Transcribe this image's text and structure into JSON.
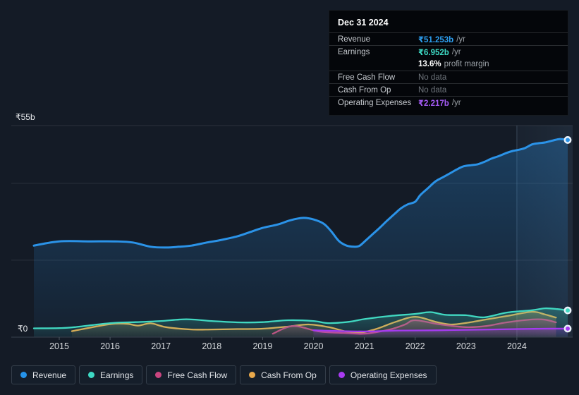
{
  "background": "#141B26",
  "tooltip": {
    "date": "Dec 31 2024",
    "rows": [
      {
        "name": "revenue",
        "label": "Revenue",
        "value": "₹51.253b",
        "suffix": "/yr",
        "value_color": "#2D9FF0",
        "no_data": false,
        "separator_above": false
      },
      {
        "name": "earnings",
        "label": "Earnings",
        "value": "₹6.952b",
        "suffix": "/yr",
        "value_color": "#3DD9C4",
        "no_data": false,
        "separator_above": true
      },
      {
        "name": "profit-margin",
        "label": "",
        "value": "13.6%",
        "suffix": "profit margin",
        "value_color": "#FFFFFF",
        "no_data": false,
        "separator_above": false
      },
      {
        "name": "free-cash-flow",
        "label": "Free Cash Flow",
        "value": "No data",
        "suffix": "",
        "value_color": "#6E747B",
        "no_data": true,
        "separator_above": true
      },
      {
        "name": "cash-from-op",
        "label": "Cash From Op",
        "value": "No data",
        "suffix": "",
        "value_color": "#6E747B",
        "no_data": true,
        "separator_above": true
      },
      {
        "name": "operating-expenses",
        "label": "Operating Expenses",
        "value": "₹2.217b",
        "suffix": "/yr",
        "value_color": "#A55BF5",
        "no_data": false,
        "separator_above": true
      }
    ]
  },
  "axis": {
    "y_top_label": "₹55b",
    "y_zero_label": "₹0"
  },
  "legend": {
    "items": [
      {
        "label": "Revenue",
        "color": "#2593EA"
      },
      {
        "label": "Earnings",
        "color": "#3DD9C4"
      },
      {
        "label": "Free Cash Flow",
        "color": "#C9457F"
      },
      {
        "label": "Cash From Op",
        "color": "#E9A94B"
      },
      {
        "label": "Operating Expenses",
        "color": "#A93BF2"
      }
    ]
  },
  "chart_data": {
    "type": "area",
    "unit": "₹ billions /yr",
    "ylim": [
      0,
      55
    ],
    "y_gridline_values": [
      55,
      40,
      20
    ],
    "y_axis_labels": {
      "top": "₹55b",
      "bottom": "₹0"
    },
    "x_ticks": [
      2015,
      2016,
      2017,
      2018,
      2019,
      2020,
      2021,
      2022,
      2023,
      2024
    ],
    "x_range": [
      2014.5,
      2025.05
    ],
    "highlight_from_x": 2024,
    "legend_position": "bottom",
    "grid": true,
    "series": [
      {
        "name": "Revenue",
        "color": "#2B93E8",
        "end_marker": true,
        "points": [
          [
            2014.5,
            23.8
          ],
          [
            2015,
            24.9
          ],
          [
            2015.6,
            24.9
          ],
          [
            2016.1,
            24.9
          ],
          [
            2016.45,
            24.6
          ],
          [
            2016.8,
            23.5
          ],
          [
            2017.1,
            23.3
          ],
          [
            2017.35,
            23.5
          ],
          [
            2017.6,
            23.8
          ],
          [
            2017.9,
            24.6
          ],
          [
            2018.2,
            25.3
          ],
          [
            2018.5,
            26.2
          ],
          [
            2018.75,
            27.3
          ],
          [
            2019,
            28.4
          ],
          [
            2019.3,
            29.3
          ],
          [
            2019.55,
            30.4
          ],
          [
            2019.8,
            31.0
          ],
          [
            2020,
            30.6
          ],
          [
            2020.2,
            29.5
          ],
          [
            2020.35,
            27.5
          ],
          [
            2020.5,
            25.0
          ],
          [
            2020.65,
            23.8
          ],
          [
            2020.8,
            23.5
          ],
          [
            2020.9,
            23.7
          ],
          [
            2021,
            24.8
          ],
          [
            2021.15,
            26.6
          ],
          [
            2021.3,
            28.4
          ],
          [
            2021.45,
            30.3
          ],
          [
            2021.6,
            32.1
          ],
          [
            2021.72,
            33.5
          ],
          [
            2021.85,
            34.5
          ],
          [
            2022,
            35.2
          ],
          [
            2022.1,
            36.9
          ],
          [
            2022.25,
            38.7
          ],
          [
            2022.4,
            40.5
          ],
          [
            2022.55,
            41.6
          ],
          [
            2022.7,
            42.7
          ],
          [
            2022.82,
            43.6
          ],
          [
            2022.95,
            44.4
          ],
          [
            2023.1,
            44.7
          ],
          [
            2023.22,
            44.9
          ],
          [
            2023.35,
            45.5
          ],
          [
            2023.5,
            46.4
          ],
          [
            2023.65,
            47.1
          ],
          [
            2023.8,
            47.9
          ],
          [
            2023.92,
            48.4
          ],
          [
            2024,
            48.6
          ],
          [
            2024.15,
            49.1
          ],
          [
            2024.3,
            50.1
          ],
          [
            2024.42,
            50.4
          ],
          [
            2024.55,
            50.6
          ],
          [
            2024.7,
            51.1
          ],
          [
            2024.85,
            51.5
          ],
          [
            2025,
            51.253
          ]
        ]
      },
      {
        "name": "Cash From Op",
        "color": "#E7A74A",
        "end_marker": false,
        "points": [
          [
            2015.25,
            1.55
          ],
          [
            2015.8,
            2.95
          ],
          [
            2016.1,
            3.5
          ],
          [
            2016.35,
            3.45
          ],
          [
            2016.55,
            3.0
          ],
          [
            2016.8,
            3.6
          ],
          [
            2017.1,
            2.6
          ],
          [
            2017.6,
            2.0
          ],
          [
            2018,
            2.0
          ],
          [
            2018.5,
            2.1
          ],
          [
            2019,
            2.2
          ],
          [
            2019.5,
            2.75
          ],
          [
            2019.9,
            3.3
          ],
          [
            2020.3,
            2.6
          ],
          [
            2020.8,
            1.1
          ],
          [
            2021.2,
            2.0
          ],
          [
            2021.6,
            3.9
          ],
          [
            2022,
            5.3
          ],
          [
            2022.4,
            4.0
          ],
          [
            2022.7,
            3.3
          ],
          [
            2023,
            3.7
          ],
          [
            2023.4,
            4.6
          ],
          [
            2023.8,
            5.5
          ],
          [
            2024.3,
            6.6
          ],
          [
            2024.55,
            5.9
          ],
          [
            2024.77,
            5.1
          ]
        ]
      },
      {
        "name": "Free Cash Flow",
        "color": "#C9487F",
        "end_marker": false,
        "points": [
          [
            2019.2,
            0.9
          ],
          [
            2019.6,
            2.9
          ],
          [
            2020.1,
            1.5
          ],
          [
            2020.6,
            1.1
          ],
          [
            2021,
            0.9
          ],
          [
            2021.5,
            2.0
          ],
          [
            2021.8,
            3.3
          ],
          [
            2022,
            4.4
          ],
          [
            2022.5,
            3.3
          ],
          [
            2023,
            2.6
          ],
          [
            2023.4,
            2.9
          ],
          [
            2023.8,
            3.85
          ],
          [
            2024.3,
            4.6
          ],
          [
            2024.55,
            4.55
          ],
          [
            2024.77,
            3.85
          ]
        ]
      },
      {
        "name": "Earnings",
        "color": "#41D8C1",
        "end_marker": true,
        "points": [
          [
            2014.5,
            2.3
          ],
          [
            2015,
            2.35
          ],
          [
            2015.3,
            2.6
          ],
          [
            2016,
            3.65
          ],
          [
            2016.5,
            3.9
          ],
          [
            2017,
            4.2
          ],
          [
            2017.5,
            4.65
          ],
          [
            2018,
            4.2
          ],
          [
            2018.5,
            3.85
          ],
          [
            2019,
            3.9
          ],
          [
            2019.5,
            4.4
          ],
          [
            2020,
            4.2
          ],
          [
            2020.3,
            3.65
          ],
          [
            2020.7,
            4.0
          ],
          [
            2021,
            4.7
          ],
          [
            2021.5,
            5.5
          ],
          [
            2022,
            6.05
          ],
          [
            2022.3,
            6.5
          ],
          [
            2022.6,
            5.8
          ],
          [
            2023,
            5.7
          ],
          [
            2023.35,
            5.15
          ],
          [
            2023.8,
            6.4
          ],
          [
            2024.3,
            7.0
          ],
          [
            2024.55,
            7.5
          ],
          [
            2024.8,
            7.3
          ],
          [
            2025,
            6.952
          ]
        ]
      },
      {
        "name": "Operating Expenses",
        "color": "#A43BF0",
        "end_marker": true,
        "points": [
          [
            2020,
            1.8
          ],
          [
            2020.6,
            1.55
          ],
          [
            2021.1,
            1.5
          ],
          [
            2021.6,
            1.7
          ],
          [
            2022,
            1.75
          ],
          [
            2022.5,
            1.8
          ],
          [
            2023,
            1.9
          ],
          [
            2023.5,
            2.0
          ],
          [
            2024,
            2.1
          ],
          [
            2024.5,
            2.2
          ],
          [
            2025,
            2.217
          ]
        ]
      }
    ]
  }
}
